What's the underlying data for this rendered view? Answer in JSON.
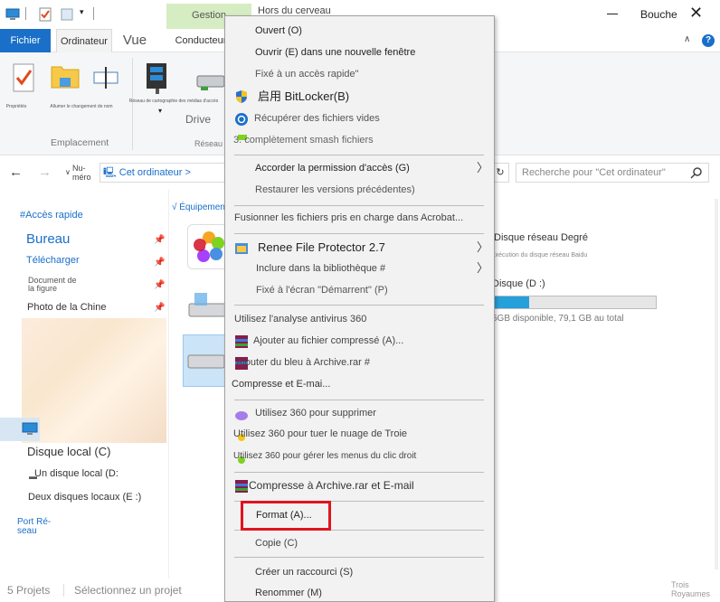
{
  "titlebar": {
    "context_tab": "Gestion",
    "title": "Hors du cerveau",
    "close_label": "Bouche"
  },
  "tabs": {
    "file": "Fichier",
    "computer": "Ordinateur",
    "view": "Vue",
    "drive": "Conducteur"
  },
  "ribbon": {
    "properties": "Propriétés",
    "change_name": "Allumer le changement de nom",
    "map_drive": "Réseau de cartographie des médias d'accès",
    "drive_label": "Drive",
    "group_location": "Emplacement",
    "group_network": "Réseau"
  },
  "nav": {
    "recent": "Nu-\nméro",
    "address": "Cet ordinateur",
    "search_placeholder": "Recherche pour \"Cet ordinateur\""
  },
  "sidebar": {
    "quick_access": "#Accès rapide",
    "desktop": "Bureau",
    "downloads": "Télécharger",
    "documents": "Document de\nla figure",
    "pictures": "Photo de la Chine",
    "local_c": "Disque local (C)",
    "local_d": "Un disque local (D:",
    "local_e": "Deux disques locaux (E :)",
    "network": "Port Ré-\nseau"
  },
  "main": {
    "group_header": "√ Équipement",
    "net_disk": "Disque réseau Degré",
    "net_disk_sub": "Exécution du disque réseau Baidu",
    "disk_d": "Disque (D :)",
    "disk_d_free": "5GB disponible, 79,1 GB au total",
    "disk_d_used_fraction": 0.22
  },
  "status": {
    "items": "5 Projets",
    "select": "Sélectionnez un projet",
    "corner": "Trois\nRoyaumes"
  },
  "menu": {
    "open": "Ouvert (O)",
    "open_new_window": "Ouvrir (E) dans une nouvelle fenêtre",
    "pin_quick": "Fixé à un accès rapide\"",
    "bitlocker": "启用 BitLocker(B)",
    "recover": "Récupérer des fichiers vides",
    "smash": "3. complètement smash fichiers",
    "grant_access": "Accorder la permission d'accès (G)",
    "restore": "Restaurer les versions précédentes)",
    "acrobat": "Fusionner les fichiers pris en charge dans Acrobat...",
    "renee": "Renee File Protector 2.7",
    "library": "Inclure dans la bibliothèque #",
    "pin_start": "Fixé à l'écran \"Démarrent\" (P)",
    "antivirus": "Utilisez l'analyse antivirus 360",
    "add_archive": "Ajouter au fichier compressé (A)...",
    "add_rar": "Ajouter du bleu à Archive.rar #",
    "compress_email": "Compresse et E-mai...",
    "delete360": "Utilisez 360 pour supprimer",
    "troy360": "Utilisez 360 pour tuer le nuage de Troie",
    "menus360": "Utilisez 360 pour gérer les menus du clic droit",
    "compress_rar_email": "Compresse à Archive.rar et E-mail",
    "format": "Format (A)...",
    "copy": "Copie (C)",
    "shortcut": "Créer un raccourci (S)",
    "rename": "Renommer (M)"
  },
  "colors": {
    "accent": "#1a6fc9",
    "highlight_box": "#e0141e",
    "context_tab_bg": "#d6ecc2"
  }
}
